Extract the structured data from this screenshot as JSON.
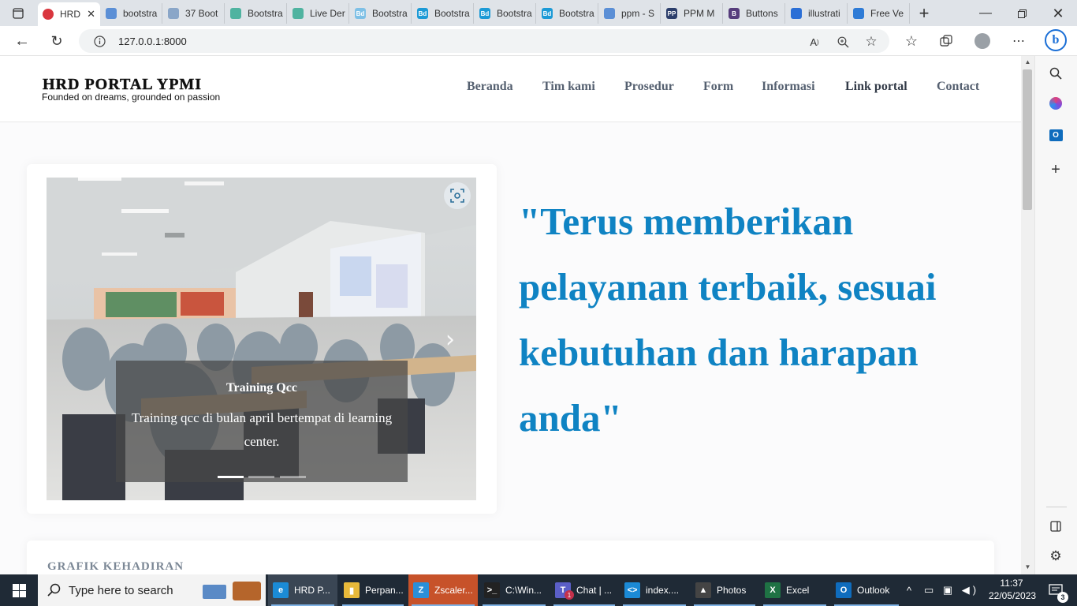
{
  "browser": {
    "tabs": [
      {
        "label": "HRD",
        "icon": "hrd-favicon",
        "color": "#d9363e",
        "active": true
      },
      {
        "label": "bootstra",
        "icon": "search-icon",
        "color": "#5b8fd6"
      },
      {
        "label": "37 Boot",
        "icon": "page-icon",
        "color": "#8aa6c8"
      },
      {
        "label": "Bootstra",
        "icon": "shield-icon",
        "color": "#4fb3a0"
      },
      {
        "label": "Live Der",
        "icon": "shield-icon",
        "color": "#4fb3a0"
      },
      {
        "label": "Bootstra",
        "icon": "bd-icon",
        "color": "#7ec0e6"
      },
      {
        "label": "Bootstra",
        "icon": "bd-icon",
        "color": "#1c9ad6"
      },
      {
        "label": "Bootstra",
        "icon": "bd-icon",
        "color": "#1c9ad6"
      },
      {
        "label": "Bootstra",
        "icon": "bd-icon",
        "color": "#1c9ad6"
      },
      {
        "label": "ppm - S",
        "icon": "search-icon",
        "color": "#5b8fd6"
      },
      {
        "label": "PPM M",
        "icon": "ppm-icon",
        "color": "#2c3e6b"
      },
      {
        "label": "Buttons",
        "icon": "bootstrap-icon",
        "color": "#563d7c"
      },
      {
        "label": "illustrati",
        "icon": "search-icon",
        "color": "#2b6fd6"
      },
      {
        "label": "Free Ve",
        "icon": "vecteezy-icon",
        "color": "#2e7bd6"
      }
    ],
    "tab_letters": [
      "",
      "",
      "",
      "",
      "",
      "Bd",
      "Bd",
      "Bd",
      "Bd",
      "",
      "PP",
      "B",
      "",
      ""
    ],
    "url": "127.0.0.1:8000"
  },
  "site": {
    "logo_title": "HRD PORTAL YPMI",
    "logo_tagline": "Founded on dreams, grounded on passion",
    "nav": [
      "Beranda",
      "Tim kami",
      "Prosedur",
      "Form",
      "Informasi",
      "Link portal",
      "Contact"
    ],
    "slide_title": "Training Qcc",
    "slide_text": "Training qcc di bulan april bertempat di learning center.",
    "slide_count": 3,
    "active_slide": 1,
    "quote": "\"Terus memberikan pelayanan terbaik, sesuai kebutuhan dan harapan anda\"",
    "section_title": "GRAFIK KEHADIRAN",
    "accent_color": "#0f83c3"
  },
  "taskbar": {
    "search_placeholder": "Type here to search",
    "apps": [
      {
        "label": "HRD P...",
        "icon": "edge-icon",
        "color": "#1b8bd6"
      },
      {
        "label": "Perpan...",
        "icon": "folder-icon",
        "color": "#e8b93a"
      },
      {
        "label": "Zscaler...",
        "icon": "zscaler-icon",
        "color": "#2a8fd8"
      },
      {
        "label": "C:\\Win...",
        "icon": "cmd-icon",
        "color": "#222222"
      },
      {
        "label": "Chat | ...",
        "icon": "teams-icon",
        "color": "#5b5fc7"
      },
      {
        "label": "index....",
        "icon": "vscode-icon",
        "color": "#1b8ad6"
      },
      {
        "label": "Photos",
        "icon": "photos-icon",
        "color": "#444444"
      },
      {
        "label": "Excel",
        "icon": "excel-icon",
        "color": "#1f7244"
      },
      {
        "label": "Outlook",
        "icon": "outlook-icon",
        "color": "#0f6cbd"
      }
    ],
    "app_letters": [
      "e",
      "▮",
      "Z",
      ">_",
      "T",
      "<>",
      "▲",
      "X",
      "O"
    ],
    "teams_badge": "1",
    "time": "11:37",
    "date": "22/05/2023",
    "notifications": "3"
  }
}
